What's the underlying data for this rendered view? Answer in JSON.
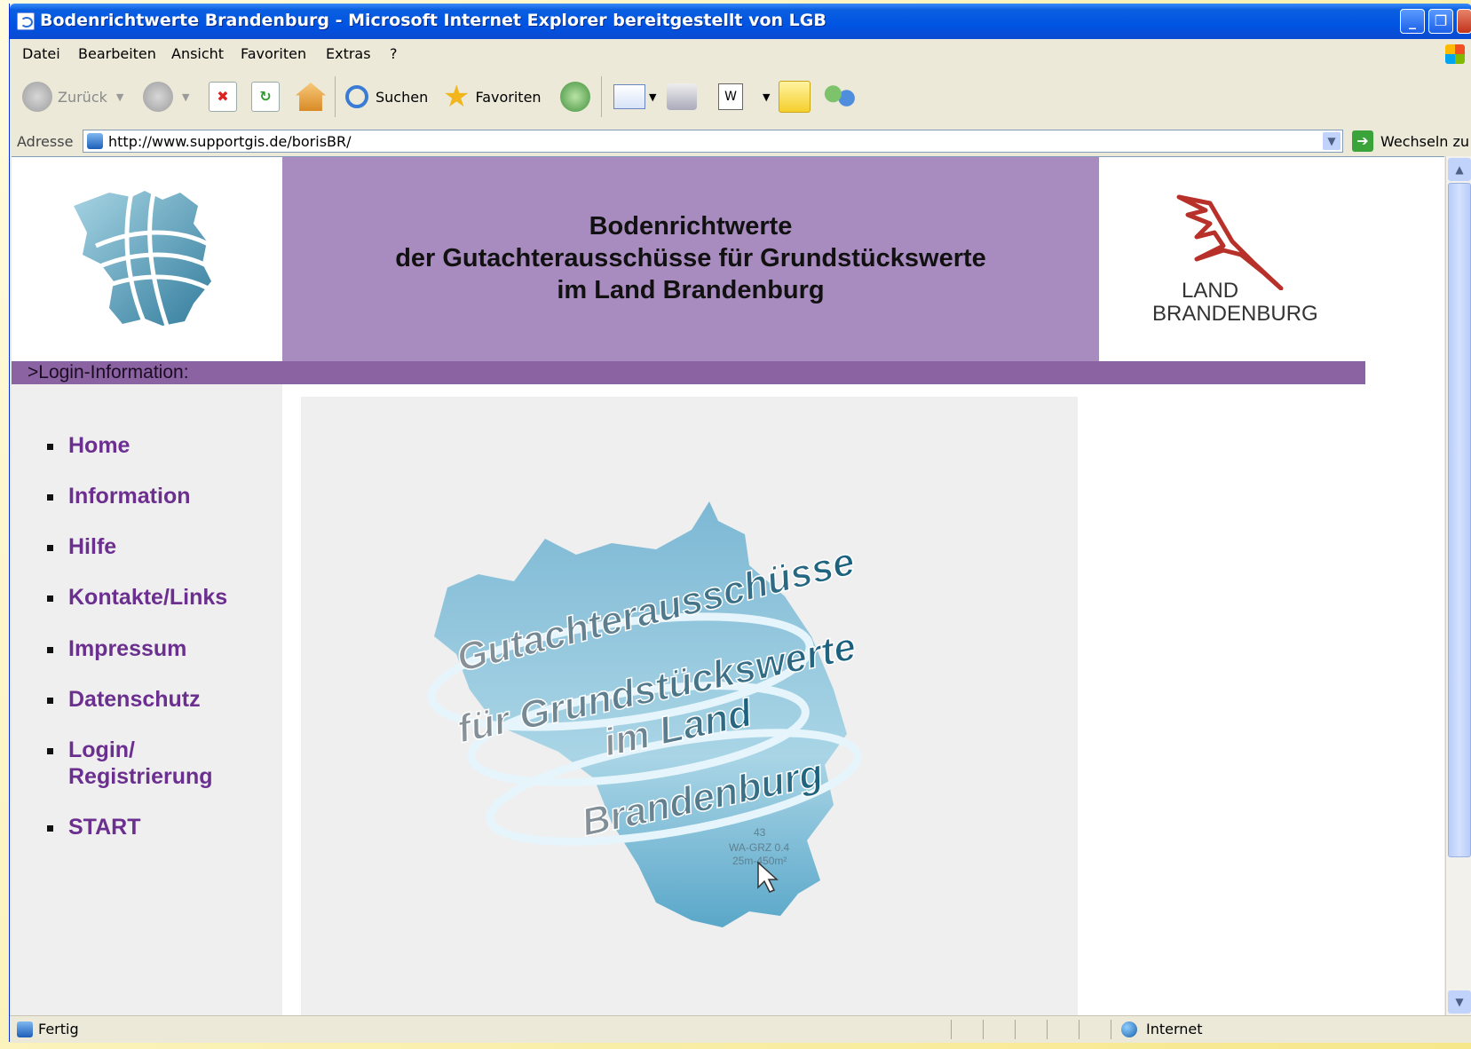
{
  "window": {
    "title": "Bodenrichtwerte Brandenburg - Microsoft Internet Explorer bereitgestellt von LGB",
    "minimize": "_",
    "maximize": "❐",
    "close": "✕"
  },
  "menu": [
    "Datei",
    "Bearbeiten",
    "Ansicht",
    "Favoriten",
    "Extras",
    "?"
  ],
  "toolbar": {
    "back": "Zurück",
    "search": "Suchen",
    "favorites": "Favoriten"
  },
  "address": {
    "label": "Adresse",
    "url": "http://www.supportgis.de/borisBR/",
    "go": "Wechseln zu"
  },
  "page": {
    "header": [
      "Bodenrichtwerte",
      "der Gutachterausschüsse für Grundstückswerte",
      "im Land Brandenburg"
    ],
    "land_logo": [
      "LAND",
      "BRANDENBURG"
    ],
    "login_bar": ">Login-Information:",
    "nav": [
      "Home",
      "Information",
      "Hilfe",
      "Kontakte/Links",
      "Impressum",
      "Datenschutz",
      "Login/",
      "Registrierung",
      "START"
    ],
    "splash_lines": [
      "Gutachterausschüsse",
      "für Grundstückswerte",
      "im Land",
      "Brandenburg"
    ],
    "splash_map_labels": [
      "43",
      "WA-GRZ 0.4",
      "25m-450m²"
    ]
  },
  "status": {
    "text": "Fertig",
    "zone": "Internet"
  }
}
